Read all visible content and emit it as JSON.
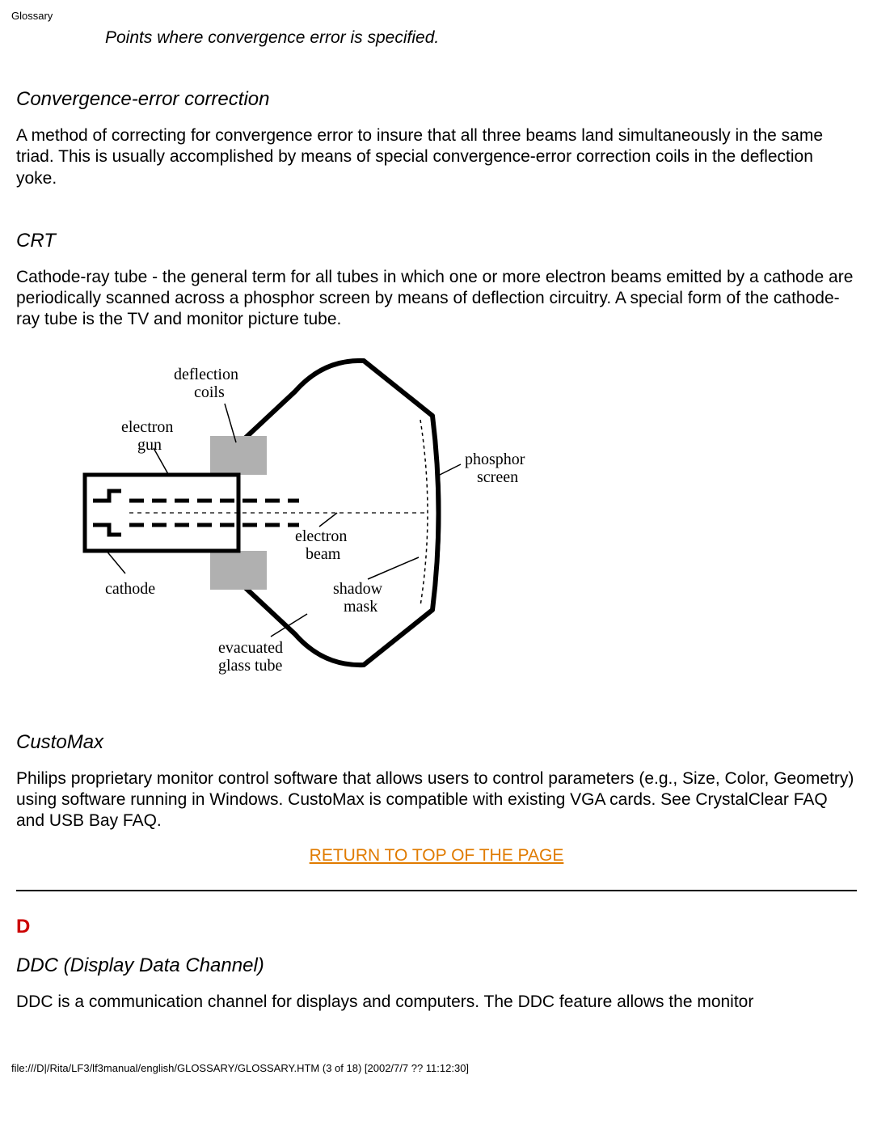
{
  "header": {
    "title": "Glossary"
  },
  "caption": "Points where convergence error is specified.",
  "entries": {
    "convergence_error_correction": {
      "term": "Convergence-error correction",
      "definition": "A method of correcting for convergence error to insure that all three beams land simultaneously in the same triad. This is usually accomplished by means of special convergence-error correction coils in the deflection yoke."
    },
    "crt": {
      "term": "CRT",
      "definition": "Cathode-ray tube - the general term for all tubes in which one or more electron beams emitted by a cathode are periodically scanned across a phosphor screen by means of deflection circuitry. A special form of the cathode-ray tube is the TV and monitor picture tube."
    },
    "customax": {
      "term": "CustoMax",
      "definition": "Philips proprietary monitor control software that allows users to control parameters (e.g., Size, Color, Geometry) using software running in Windows. CustoMax is compatible with existing VGA cards. See CrystalClear FAQ and USB Bay FAQ."
    },
    "ddc": {
      "term": "DDC (Display Data Channel)",
      "definition": "DDC is a communication channel for displays and computers. The DDC feature allows the monitor"
    }
  },
  "diagram": {
    "labels": {
      "deflection_coils": "deflection\ncoils",
      "electron_gun": "electron\ngun",
      "cathode": "cathode",
      "electron_beam": "electron\nbeam",
      "shadow_mask": "shadow\nmask",
      "evacuated_glass_tube": "evacuated\nglass tube",
      "phosphor_screen": "phosphor\nscreen"
    }
  },
  "links": {
    "return_top": "RETURN TO TOP OF THE PAGE"
  },
  "section_letter": "D",
  "footer": {
    "path": "file:///D|/Rita/LF3/lf3manual/english/GLOSSARY/GLOSSARY.HTM (3 of 18) [2002/7/7 ?? 11:12:30]"
  }
}
